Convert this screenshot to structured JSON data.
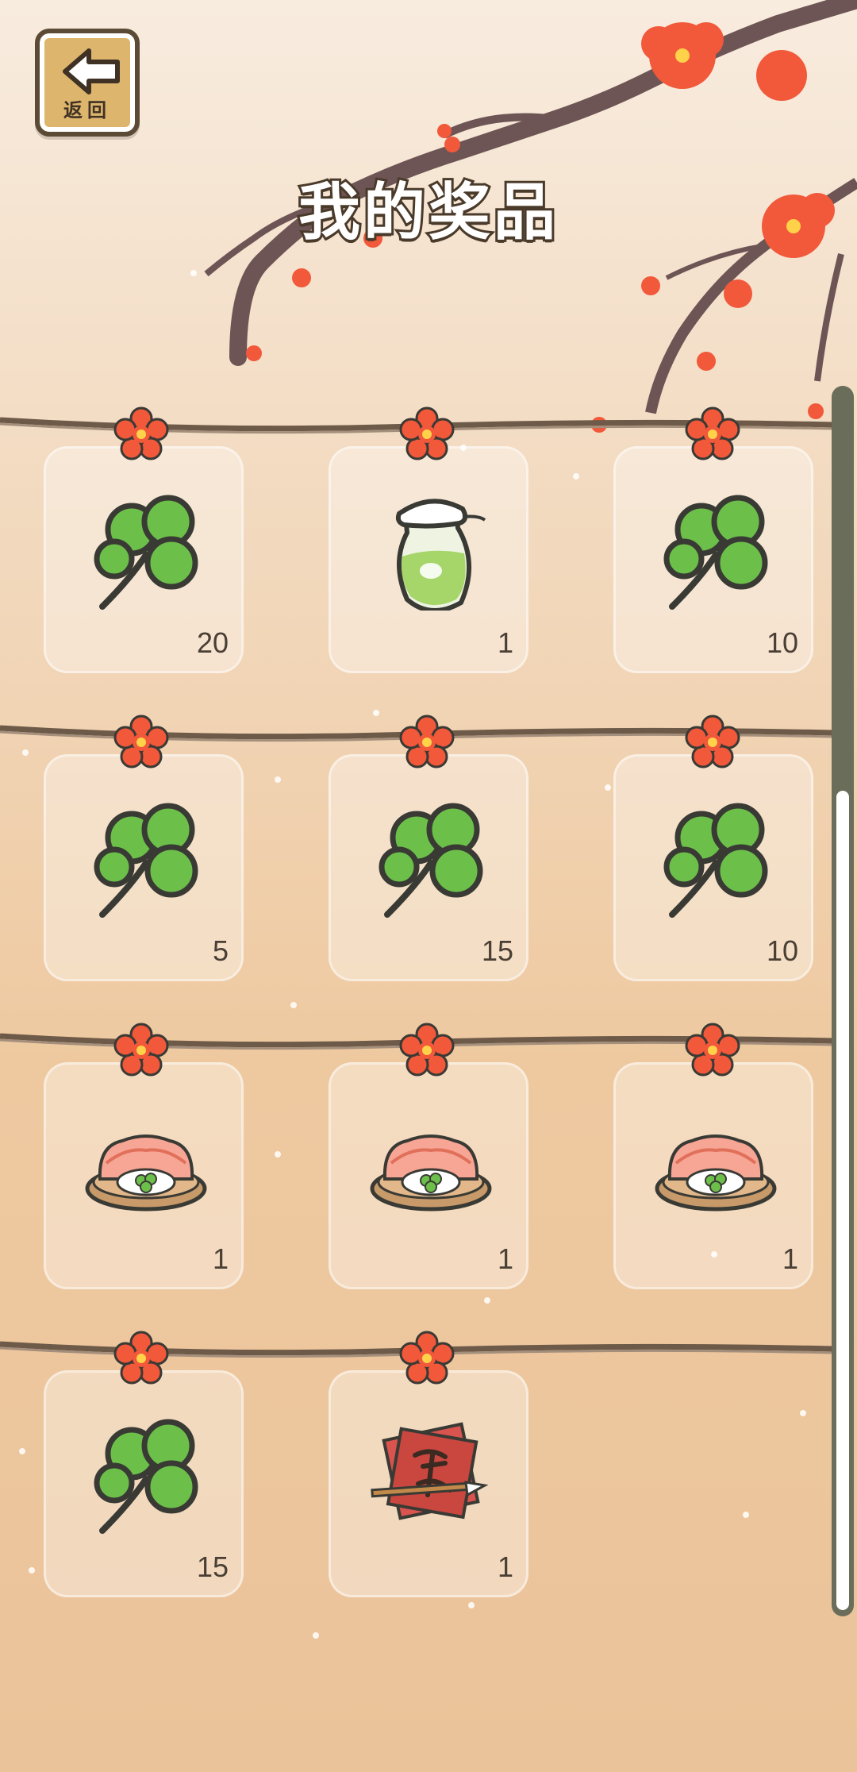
{
  "header": {
    "back_label": "返回",
    "title": "我的奖品"
  },
  "prizes": [
    {
      "item": "clover-icon",
      "count": "20"
    },
    {
      "item": "juice-jar-icon",
      "count": "1"
    },
    {
      "item": "clover-icon",
      "count": "10"
    },
    {
      "item": "clover-icon",
      "count": "5"
    },
    {
      "item": "clover-icon",
      "count": "15"
    },
    {
      "item": "clover-icon",
      "count": "10"
    },
    {
      "item": "shrimp-platter-icon",
      "count": "1"
    },
    {
      "item": "shrimp-platter-icon",
      "count": "1"
    },
    {
      "item": "shrimp-platter-icon",
      "count": "1"
    },
    {
      "item": "clover-icon",
      "count": "15"
    },
    {
      "item": "calligraphy-scroll-icon",
      "count": "1"
    }
  ],
  "colors": {
    "button_bg": "#ddb56c",
    "outline": "#4a3a2a",
    "clover": "#6cc04a",
    "blossom": "#f25a3a",
    "scroll_track": "#6a6d59"
  }
}
